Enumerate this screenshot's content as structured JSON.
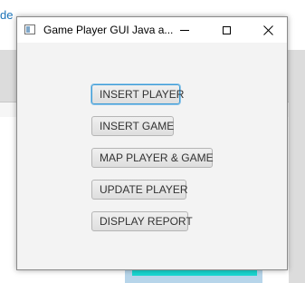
{
  "background": {
    "link_fragment": "de"
  },
  "window": {
    "title": "Game Player GUI Java a...",
    "controls": {
      "minimize": "minimize",
      "maximize": "maximize",
      "close": "close"
    },
    "buttons": [
      {
        "label": "INSERT PLAYER",
        "focused": true
      },
      {
        "label": "INSERT GAME",
        "focused": false
      },
      {
        "label": "MAP PLAYER & GAME",
        "focused": false
      },
      {
        "label": "UPDATE PLAYER",
        "focused": false
      },
      {
        "label": "DISPLAY REPORT",
        "focused": false
      }
    ]
  },
  "colors": {
    "window_bg": "#f3f3f3",
    "focus_ring": "#3e9cd6",
    "teal_accent": "#19d7d1",
    "link": "#1a73b8"
  }
}
